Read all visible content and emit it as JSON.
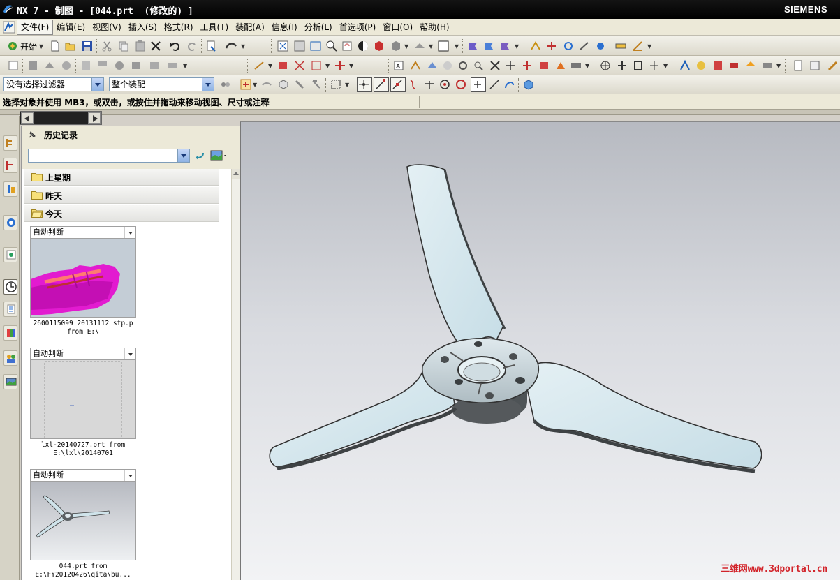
{
  "window": {
    "title": "NX 7 - 制图 - [044.prt  (修改的) ]",
    "brand": "SIEMENS"
  },
  "menu": {
    "items": [
      "文件(F)",
      "编辑(E)",
      "视图(V)",
      "插入(S)",
      "格式(R)",
      "工具(T)",
      "装配(A)",
      "信息(I)",
      "分析(L)",
      "首选项(P)",
      "窗口(O)",
      "帮助(H)"
    ]
  },
  "toolbar": {
    "start_label": "开始",
    "selection_filter": "没有选择过滤器",
    "assembly_scope": "整个装配"
  },
  "cue_line": "选择对象并使用 MB3，或双击，或按住并拖动来移动视图、尺寸或注释",
  "history_panel": {
    "title": "历史记录",
    "search_value": "",
    "groups": [
      "上星期",
      "昨天",
      "今天"
    ],
    "entries": [
      {
        "mode": "自动判断",
        "caption_line1": "2600115099_20131112_stp.p",
        "caption_line2": "from E:\\"
      },
      {
        "mode": "自动判断",
        "caption_line1": "lxl-20140727.prt from",
        "caption_line2": "E:\\lxl\\20140701"
      },
      {
        "mode": "自动判断",
        "caption_line1": "044.prt from",
        "caption_line2": "E:\\FY20120426\\qita\\bu..."
      }
    ]
  },
  "graphics": {
    "watermark": "三维网www.3dportal.cn"
  },
  "colors": {
    "title_bar": "#000000",
    "blade": "#d2e6ec",
    "hub": "#5a5f62",
    "watermark": "#d2232a",
    "pink_model": "#e020d0"
  }
}
